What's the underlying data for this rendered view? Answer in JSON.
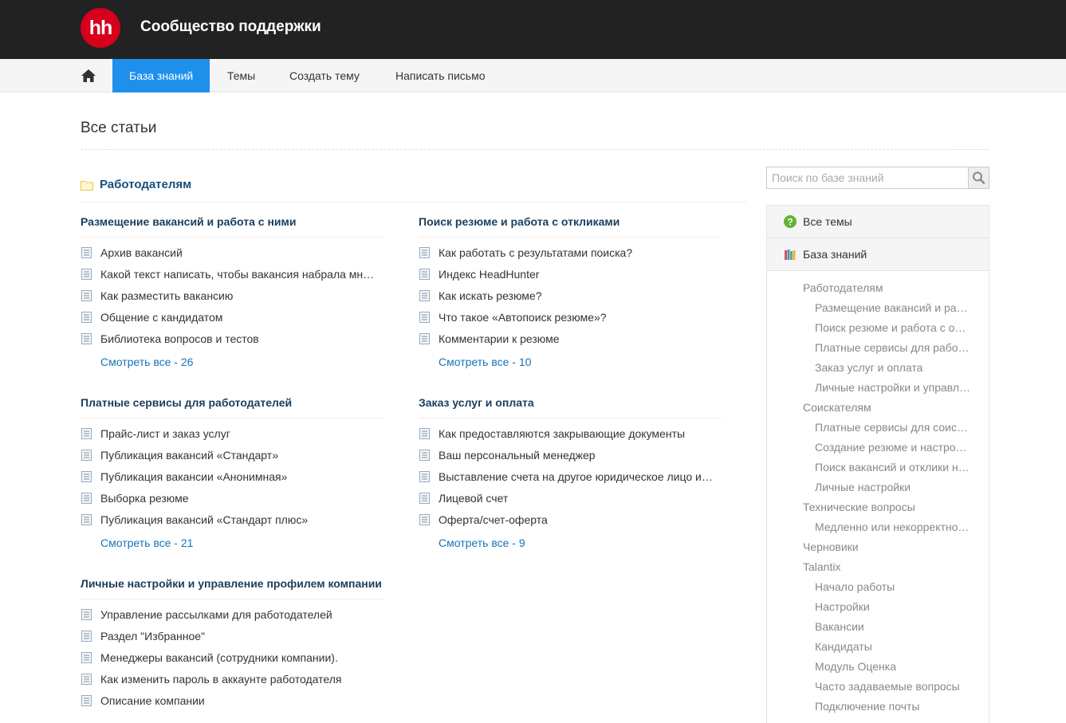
{
  "header": {
    "logo_text": "hh",
    "site_title": "Сообщество поддержки"
  },
  "nav": {
    "home_icon": "home-icon",
    "items": [
      "База знаний",
      "Темы",
      "Создать тему",
      "Написать письмо"
    ],
    "active_color": "#1e90ec"
  },
  "page_title": "Все статьи",
  "category": {
    "title": "Работодателям",
    "icon": "folder-icon"
  },
  "sections": [
    {
      "title": "Размещение вакансий и работа с ними",
      "articles": [
        "Архив вакансий",
        "Какой текст написать, чтобы вакансия набрала мн…",
        "Как разместить вакансию",
        "Общение с кандидатом",
        "Библиотека вопросов и тестов"
      ],
      "see_all": "Смотреть все - 26"
    },
    {
      "title": "Поиск резюме и работа с откликами",
      "articles": [
        "Как работать с результатами поиска?",
        "Индекс HeadHunter",
        "Как искать резюме?",
        "Что такое «Автопоиск резюме»?",
        "Комментарии к резюме"
      ],
      "see_all": "Смотреть все - 10"
    },
    {
      "title": "Платные сервисы для работодателей",
      "articles": [
        "Прайс-лист и заказ услуг",
        "Публикация вакансий «Стандарт»",
        "Публикация вакансии «Анонимная»",
        "Выборка резюме",
        "Публикация вакансий «Стандарт плюс»"
      ],
      "see_all": "Смотреть все - 21"
    },
    {
      "title": "Заказ услуг и оплата",
      "articles": [
        "Как предоставляются закрывающие документы",
        "Ваш персональный менеджер",
        "Выставление счета на другое юридическое лицо и…",
        "Лицевой счет",
        "Оферта/счет-оферта"
      ],
      "see_all": "Смотреть все - 9"
    },
    {
      "title": "Личные настройки и управление профилем компании",
      "articles": [
        "Управление рассылками для работодателей",
        "Раздел \"Избранное\"",
        "Менеджеры вакансий (сотрудники компании).",
        "Как изменить пароль в аккаунте работодателя",
        "Описание компании"
      ],
      "see_all": ""
    }
  ],
  "search": {
    "placeholder": "Поиск по базе знаний",
    "icon": "search-icon"
  },
  "sidebar": {
    "all_topics": "Все темы",
    "knowledge_base": "База знаний",
    "tree": [
      {
        "label": "Работодателям",
        "level": 1
      },
      {
        "label": "Размещение вакансий и ра…",
        "level": 2
      },
      {
        "label": "Поиск резюме и работа с о…",
        "level": 2
      },
      {
        "label": "Платные сервисы для рабо…",
        "level": 2
      },
      {
        "label": "Заказ услуг и оплата",
        "level": 2
      },
      {
        "label": "Личные настройки и управл…",
        "level": 2
      },
      {
        "label": "Соискателям",
        "level": 1
      },
      {
        "label": "Платные сервисы для соис…",
        "level": 2
      },
      {
        "label": "Создание резюме и настро…",
        "level": 2
      },
      {
        "label": "Поиск вакансий и отклики н…",
        "level": 2
      },
      {
        "label": "Личные настройки",
        "level": 2
      },
      {
        "label": "Технические вопросы",
        "level": 1
      },
      {
        "label": "Медленно или некорректно…",
        "level": 2
      },
      {
        "label": "Черновики",
        "level": 1
      },
      {
        "label": "Talantix",
        "level": 1
      },
      {
        "label": "Начало работы",
        "level": 2
      },
      {
        "label": "Настройки",
        "level": 2
      },
      {
        "label": "Вакансии",
        "level": 2
      },
      {
        "label": "Кандидаты",
        "level": 2
      },
      {
        "label": "Модуль Оценка",
        "level": 2
      },
      {
        "label": "Часто задаваемые вопросы",
        "level": 2
      },
      {
        "label": "Подключение почты",
        "level": 2
      }
    ]
  }
}
